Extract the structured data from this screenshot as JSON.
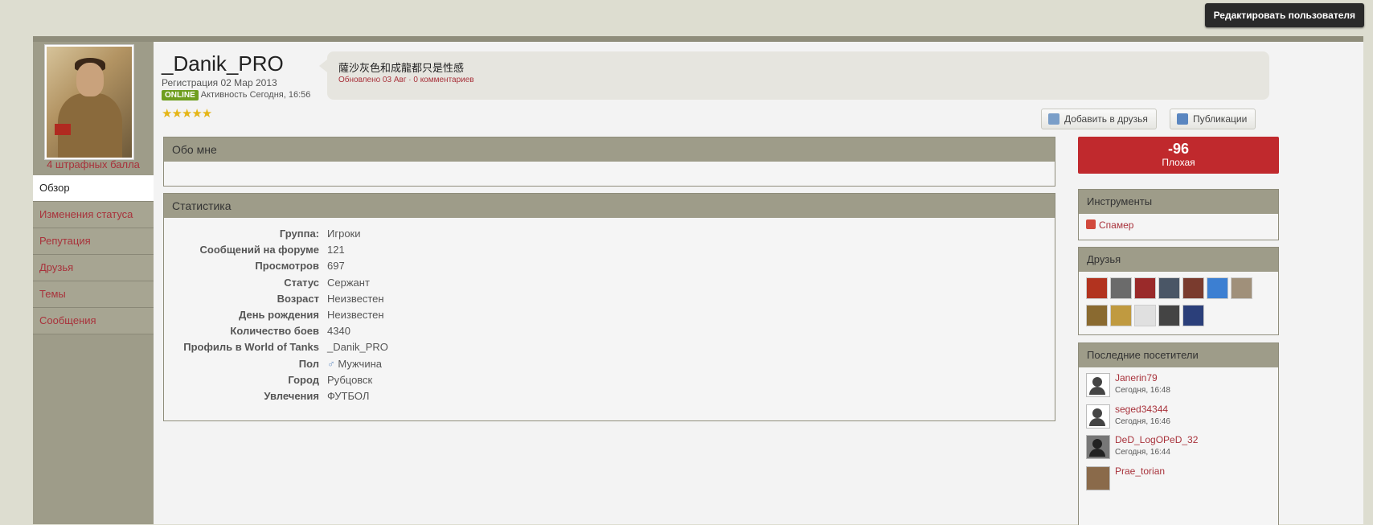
{
  "header": {
    "edit_user_label": "Редактировать пользователя"
  },
  "profile": {
    "username": "_Danik_PRO",
    "registration": "Регистрация 02 Мар 2013",
    "online_badge": "ONLINE",
    "activity": "Активность Сегодня, 16:56",
    "stars": "★★★★★",
    "penalty": "4 штрафных балла"
  },
  "status": {
    "text": "薩沙灰色和成龍都只是性感",
    "meta": "Обновлено 03 Авг · 0 комментариев"
  },
  "actions": {
    "add_friend": "Добавить в друзья",
    "publications": "Публикации"
  },
  "nav": {
    "items": [
      {
        "label": "Обзор",
        "active": true
      },
      {
        "label": "Изменения статуса"
      },
      {
        "label": "Репутация"
      },
      {
        "label": "Друзья"
      },
      {
        "label": "Темы"
      },
      {
        "label": "Сообщения"
      }
    ]
  },
  "about": {
    "title": "Обо мне"
  },
  "stats": {
    "title": "Статистика",
    "rows": [
      {
        "label": "Группа:",
        "value": "Игроки"
      },
      {
        "label": "Сообщений на форуме",
        "value": "121"
      },
      {
        "label": "Просмотров",
        "value": "697"
      },
      {
        "label": "Статус",
        "value": "Сержант"
      },
      {
        "label": "Возраст",
        "value": "Неизвестен"
      },
      {
        "label": "День рождения",
        "value": "Неизвестен"
      },
      {
        "label": "Количество боев",
        "value": "4340"
      },
      {
        "label": "Профиль в World of Tanks",
        "value": "_Danik_PRO"
      },
      {
        "label": "Пол",
        "value": "Мужчина"
      },
      {
        "label": "Город",
        "value": "Рубцовск"
      },
      {
        "label": "Увлечения",
        "value": "ФУТБОЛ"
      }
    ]
  },
  "reputation": {
    "value": "-96",
    "label": "Плохая",
    "color": "#c0292d"
  },
  "tools": {
    "title": "Инструменты",
    "spammer": "Спамер"
  },
  "friends": {
    "title": "Друзья",
    "colors": [
      "#b2331f",
      "#6b6b6b",
      "#9a2a2a",
      "#4a5666",
      "#7a3b2e",
      "#3c7fd2",
      "#a0907a",
      "#8a6a30",
      "#c09a40",
      "#e0e0e0",
      "#444444",
      "#2b3f7a"
    ]
  },
  "visitors": {
    "title": "Последние посетители",
    "items": [
      {
        "name": "Janerin79",
        "time": "Сегодня, 16:48"
      },
      {
        "name": "seged34344",
        "time": "Сегодня, 16:46"
      },
      {
        "name": "DeD_LogOPeD_32",
        "time": "Сегодня, 16:44"
      },
      {
        "name": "Prae_torian",
        "time": ""
      }
    ]
  }
}
